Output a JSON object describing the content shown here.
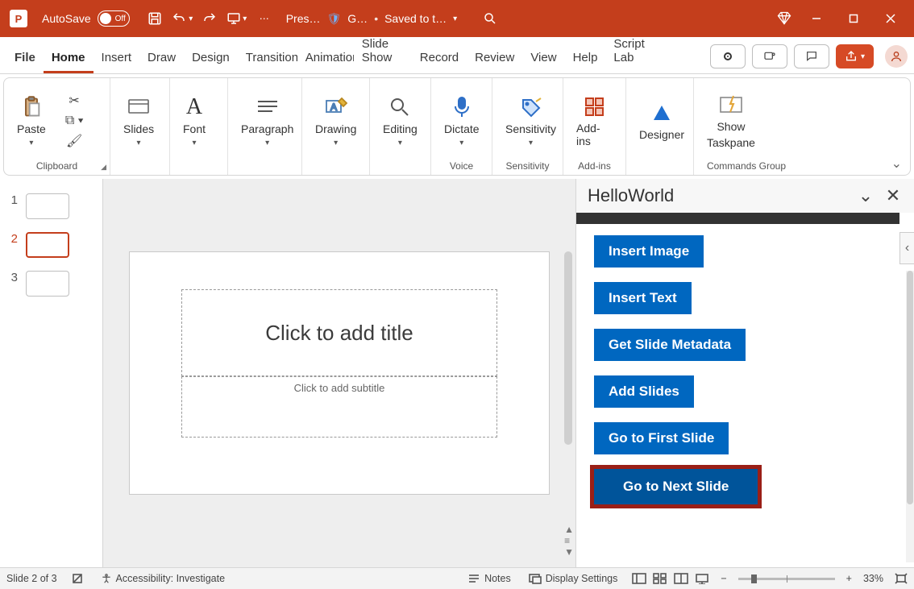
{
  "titlebar": {
    "autosave_label": "AutoSave",
    "autosave_state": "Off",
    "doc_name": "Pres…",
    "sensitivity_badge": "G…",
    "save_state": "Saved to t…"
  },
  "tabs": {
    "items": [
      "File",
      "Home",
      "Insert",
      "Draw",
      "Design",
      "Transition",
      "Animation",
      "Slide Show",
      "Record",
      "Review",
      "View",
      "Help",
      "Script Lab"
    ],
    "active_index": 1
  },
  "ribbon": {
    "clipboard": {
      "paste": "Paste",
      "group": "Clipboard"
    },
    "slides": {
      "label": "Slides"
    },
    "font": {
      "label": "Font"
    },
    "paragraph": {
      "label": "Paragraph"
    },
    "drawing": {
      "label": "Drawing"
    },
    "editing": {
      "label": "Editing"
    },
    "dictate": {
      "label": "Dictate",
      "group": "Voice"
    },
    "sensitivity": {
      "label": "Sensitivity",
      "group": "Sensitivity"
    },
    "addins": {
      "label": "Add-ins",
      "group": "Add-ins"
    },
    "designer": {
      "label": "Designer"
    },
    "showtaskpane": {
      "label1": "Show",
      "label2": "Taskpane",
      "group": "Commands Group"
    }
  },
  "thumbnails": {
    "count": 3,
    "active": 2,
    "numbers": [
      "1",
      "2",
      "3"
    ]
  },
  "slide": {
    "title_placeholder": "Click to add title",
    "subtitle_placeholder": "Click to add subtitle"
  },
  "taskpane": {
    "title": "HelloWorld",
    "buttons": [
      "Insert Image",
      "Insert Text",
      "Get Slide Metadata",
      "Add Slides",
      "Go to First Slide",
      "Go to Next Slide"
    ],
    "highlight_index": 5
  },
  "status": {
    "slide_indicator": "Slide 2 of 3",
    "accessibility": "Accessibility: Investigate",
    "notes": "Notes",
    "display": "Display Settings",
    "zoom_pct": "33%"
  }
}
